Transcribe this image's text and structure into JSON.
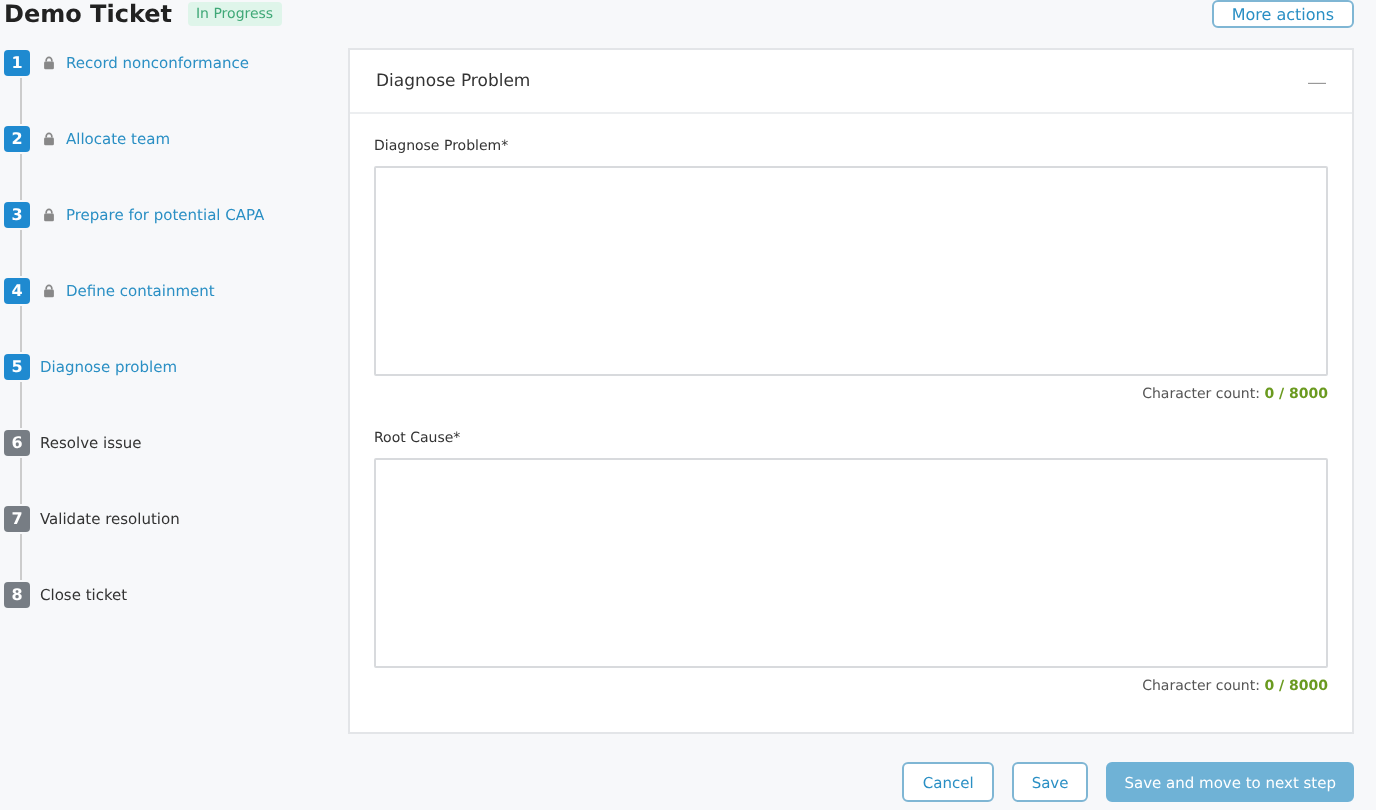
{
  "header": {
    "title": "Demo Ticket",
    "status": "In Progress",
    "more_button": "More actions"
  },
  "steps": [
    {
      "number": "1",
      "label": "Record nonconformance",
      "reachable": true,
      "locked": true
    },
    {
      "number": "2",
      "label": "Allocate team",
      "reachable": true,
      "locked": true
    },
    {
      "number": "3",
      "label": "Prepare for potential CAPA",
      "reachable": true,
      "locked": true
    },
    {
      "number": "4",
      "label": "Define containment",
      "reachable": true,
      "locked": true
    },
    {
      "number": "5",
      "label": "Diagnose problem",
      "reachable": true,
      "locked": false
    },
    {
      "number": "6",
      "label": "Resolve issue",
      "reachable": false,
      "locked": false
    },
    {
      "number": "7",
      "label": "Validate resolution",
      "reachable": false,
      "locked": false
    },
    {
      "number": "8",
      "label": "Close ticket",
      "reachable": false,
      "locked": false
    }
  ],
  "card": {
    "title": "Diagnose Problem",
    "collapse": "—",
    "fields": [
      {
        "label": "Diagnose Problem*",
        "count_label": "Character count:",
        "count": "0 / 8000"
      },
      {
        "label": "Root Cause*",
        "count_label": "Character count:",
        "count": "0 / 8000"
      }
    ]
  },
  "buttons": {
    "cancel": "Cancel",
    "save": "Save",
    "next": "Save and move to next step"
  }
}
